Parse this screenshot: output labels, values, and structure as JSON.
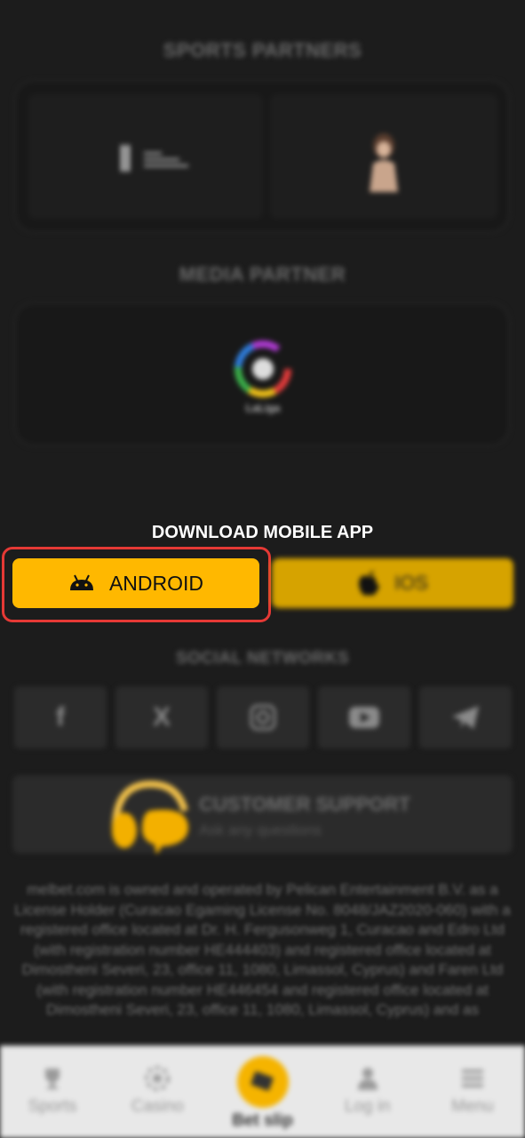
{
  "sections": {
    "sports_partners_title": "SPORTS PARTNERS",
    "media_partner_title": "MEDIA PARTNER",
    "media_partner_logo_text": "LaLiga",
    "download_title": "DOWNLOAD MOBILE APP",
    "social_title": "SOCIAL NETWORKS"
  },
  "app_buttons": {
    "android_label": "ANDROID",
    "ios_label": "IOS"
  },
  "social_icons": [
    "facebook-icon",
    "x-icon",
    "instagram-icon",
    "youtube-icon",
    "telegram-icon"
  ],
  "support": {
    "title": "CUSTOMER SUPPORT",
    "subtitle": "Ask any questions"
  },
  "legal_text": "melbet.com is owned and operated by Pelican Entertainment B.V. as a License Holder (Curacao Egaming License No. 8048/JAZ2020-060) with a registered office located at Dr. H. Fergusonweg 1, Curacao and Edro Ltd (with registration number HE444403) and registered office located at Dimostheni Severi, 23, office 11, 1080, Limassol, Cyprus) and Faren Ltd (with registration number HE446454 and registered office located at Dimostheni Severi, 23, office 11, 1080, Limassol, Cyprus) and as",
  "tabbar": {
    "sports": "Sports",
    "casino": "Casino",
    "betslip": "Bet slip",
    "login": "Log in",
    "menu": "Menu"
  },
  "colors": {
    "accent": "#ffb800",
    "highlight": "#e53935",
    "background": "#1c1c1c"
  }
}
